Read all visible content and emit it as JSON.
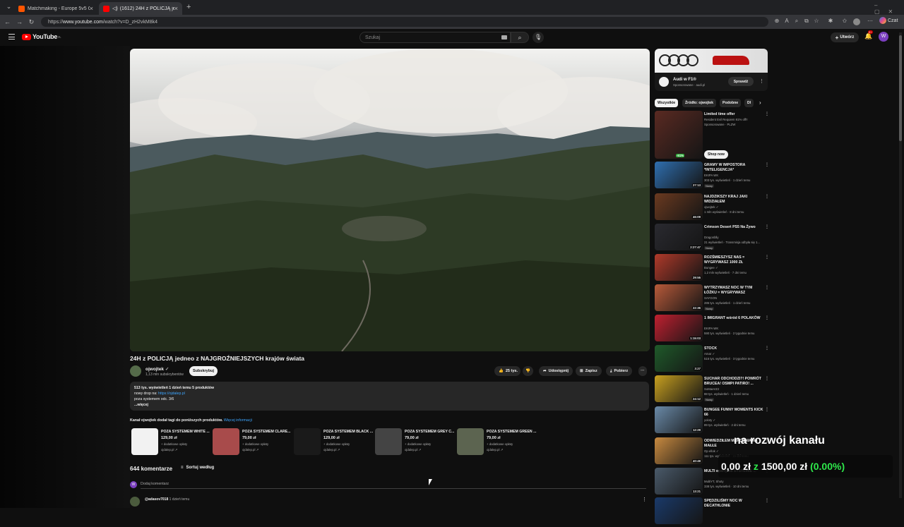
{
  "browser": {
    "tabs": [
      {
        "label": "Matchmaking - Europe 5v5 Queue"
      },
      {
        "label": "(1612) 24H z POLICJĄ jedneg"
      }
    ],
    "new_tab": "+",
    "url_prefix": "https://",
    "url_domain": "www.youtube.com",
    "url_path": "/watch?v=D_zH2vkM8k4",
    "chat_label": "Czat"
  },
  "header": {
    "logo_text": "YouTube",
    "logo_sup": "PL",
    "search_placeholder": "Szukaj",
    "create_label": "Utwórz",
    "notif_count": "9+",
    "avatar_letter": "W"
  },
  "video": {
    "title": "24H z POLICJĄ jedneo z NAJGROŹNIEJSZYCH krajów świata",
    "channel": "ojwojtek",
    "verified": "✓",
    "subs": "1,13 mln subskrybentów",
    "subscribe": "Subskrybuj",
    "likes": "25 tys.",
    "share": "Udostępnij",
    "save": "Zapisz",
    "download": "Pobierz"
  },
  "description": {
    "stats": "513 tys. wyświetleń  1 dzień temu  5 produktów",
    "line2_prefix": "nowy drop na: ",
    "line2_link": "https://ojdalep.pl",
    "line3": "poza systemem odc. 3/6",
    "more": "...więcej"
  },
  "products": {
    "heading": "Kanał ojwojtek dodał tagi do poniższych produktów.",
    "more_link": "Więcej informacji",
    "items": [
      {
        "title": "POZA SYSTEMEM WHITE ...",
        "price": "129,00 zł",
        "fees": "+ dodatkowe opłaty",
        "shop": "ojdalep.pl ↗",
        "color": "#f2f2f2"
      },
      {
        "title": "POZA SYSTEMEM CLARE...",
        "price": "79,00 zł",
        "fees": "+ dodatkowe opłaty",
        "shop": "ojdalep.pl ↗",
        "color": "#a84b4b"
      },
      {
        "title": "POZA SYSTEMEM BLACK ...",
        "price": "129,00 zł",
        "fees": "+ dodatkowe opłaty",
        "shop": "ojdalep.pl ↗",
        "color": "#1a1a1a"
      },
      {
        "title": "POZA SYSTEMEM GREY C...",
        "price": "79,00 zł",
        "fees": "+ dodatkowe opłaty",
        "shop": "ojdalep.pl ↗",
        "color": "#444444"
      },
      {
        "title": "POZA SYSTEMEM GREEN ...",
        "price": "79,00 zł",
        "fees": "+ dodatkowe opłaty",
        "shop": "ojdalep.pl ↗",
        "color": "#5c6450"
      }
    ]
  },
  "comments": {
    "count": "644 komentarze",
    "sort": "Sortuj według",
    "add_placeholder": "Dodaj komentarz",
    "first_user": "@adasov7018",
    "first_time": "1 dzień temu"
  },
  "ad": {
    "name": "Audi w F1®",
    "sponsored": "Sponsorowane · audi.pl",
    "button": "Sprawdź"
  },
  "chips": [
    {
      "label": "Wszystkie"
    },
    {
      "label": "Źródło: ojwojtek"
    },
    {
      "label": "Podobne"
    },
    {
      "label": "Dl"
    }
  ],
  "recommendations": [
    {
      "title": "Limited time offer",
      "channel": "Resident Evil Requiem 91% off!!",
      "meta": "Sponsorowane · PLZW",
      "badge": "",
      "duration": "",
      "thumb": "#5a2a22",
      "button": "Shop now",
      "discount": "-91%"
    },
    {
      "title": "GRAMY W IMPOSTORA *INTELIGENCJA*",
      "channel": "EKIPA WK",
      "meta": "303 tys. wyświetleń · 1 dzień temu",
      "badge": "Nowy",
      "duration": "27:13",
      "thumb": "#2f6fb0"
    },
    {
      "title": "NAJDZIKSZY KRAJ JAKI WIDZIAŁEM",
      "channel": "ojwojtek ✓",
      "meta": "1 mln wyświetleń · 8 dni temu",
      "badge": "",
      "duration": "46:09",
      "thumb": "#6b3a20"
    },
    {
      "title": "Crimson Desert PS5 Na Żywo",
      "channel": "Dragonblly",
      "meta": "21 wyświetleń · Transmisja odbyła się 1...",
      "badge": "Nowy",
      "duration": "2:27:47",
      "thumb": "#2a2a30"
    },
    {
      "title": "ROZŚMIESZYSZ NAS = WYGRYWASZ 1000 ZŁ",
      "channel": "Bungee ✓",
      "meta": "1,2 mln wyświetleń · 7 dni temu",
      "badge": "",
      "duration": "29:55",
      "thumb": "#b03a2a"
    },
    {
      "title": "WYTRZYMASZ NOC W TYM ŁÓŻKU = WYGRYWASZ",
      "channel": "SAYGON",
      "meta": "286 tys. wyświetleń · 1 dzień temu",
      "badge": "Nowy",
      "duration": "22:36",
      "thumb": "#b85a3a"
    },
    {
      "title": "1 IMIGRANT wśród 6 POLAKÓW",
      "channel": "EKIPA WK",
      "meta": "590 tys. wyświetleń · 2 tygodnie temu",
      "badge": "",
      "duration": "1:15:03",
      "thumb": "#c02030"
    },
    {
      "title": "STOCK",
      "channel": "Amar ✓",
      "meta": "516 tys. wyświetleń · 3 tygodnie temu",
      "badge": "",
      "duration": "3:27",
      "thumb": "#1f5a2a"
    },
    {
      "title": "SUCHAR ODCHODZI?! POWRÓT BRUCEA! OSMPI PATIRO! ...",
      "channel": "SoMaeVZJ",
      "meta": "88 tys. wyświetleń · 1 dzień temu",
      "badge": "Nowy",
      "duration": "24:12",
      "thumb": "#c8a020"
    },
    {
      "title": "BUNGEE FUNNY MOMENTS KICK 66",
      "channel": "yoloty ✓",
      "meta": "89 tys. wyświetleń · 2 dni temu",
      "badge": "",
      "duration": "12:29",
      "thumb": "#6a8aa8"
    },
    {
      "title": "ODWIEDZIŁEM MARCONIA NA MAŁŁE",
      "channel": "Op ellok ✓",
      "meta": "111 tys. wyświetleń · 15 dni temu",
      "badge": "",
      "duration": "40:49",
      "thumb": "#c88a40"
    },
    {
      "title": "MULTI oparty na SYSTEMIE ...",
      "channel": "MultiYT, Shoty",
      "meta": "338 tys. wyświetleń · 10 dni temu",
      "badge": "",
      "duration": "13:21",
      "thumb": "#4a5a6a"
    },
    {
      "title": "SPĘDZILIŚMY NOC W DECATHLONIE",
      "channel": "",
      "meta": "",
      "badge": "",
      "duration": "",
      "thumb": "#1a3a6a"
    }
  ],
  "overlay": {
    "title": "na rozwój kanału",
    "amount": "0,00 zł",
    "of": "z",
    "goal": "1500,00 zł",
    "percent": "(0.00%)",
    "progress": 0
  }
}
